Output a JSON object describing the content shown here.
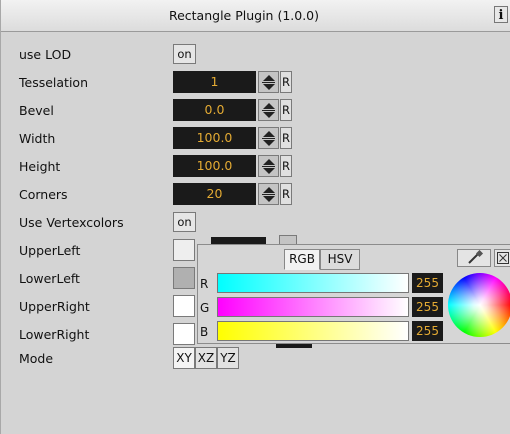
{
  "window": {
    "title": "Rectangle Plugin (1.0.0)",
    "info_label": "i"
  },
  "rows": {
    "use_lod": {
      "label": "use LOD",
      "value": "on"
    },
    "tesselation": {
      "label": "Tesselation",
      "value": "1",
      "reset": "R"
    },
    "bevel": {
      "label": "Bevel",
      "value": "0.0",
      "reset": "R"
    },
    "width": {
      "label": "Width",
      "value": "100.0",
      "reset": "R"
    },
    "height": {
      "label": "Height",
      "value": "100.0",
      "reset": "R"
    },
    "corners": {
      "label": "Corners",
      "value": "20",
      "reset": "R"
    },
    "use_vertexcolors": {
      "label": "Use Vertexcolors",
      "value": "on"
    },
    "upper_left": {
      "label": "UpperLeft",
      "color": "#eeeeee"
    },
    "lower_left": {
      "label": "LowerLeft",
      "color": "#b0b0b0"
    },
    "upper_right": {
      "label": "UpperRight",
      "color": "#ffffff"
    },
    "lower_right": {
      "label": "LowerRight",
      "color": "#ffffff"
    },
    "mode": {
      "label": "Mode",
      "options": [
        "XY",
        "XZ",
        "YZ"
      ],
      "selected": "XY"
    }
  },
  "color_picker": {
    "tabs": [
      "RGB",
      "HSV"
    ],
    "active_tab": "RGB",
    "channels": [
      {
        "label": "R",
        "value": "255"
      },
      {
        "label": "G",
        "value": "255"
      },
      {
        "label": "B",
        "value": "255"
      }
    ],
    "icons": [
      "eyedropper-icon",
      "close-box-icon"
    ]
  },
  "colors": {
    "panel_bg": "#d4d4d4",
    "field_bg": "#1a1a1a",
    "field_text": "#e3aa33"
  }
}
